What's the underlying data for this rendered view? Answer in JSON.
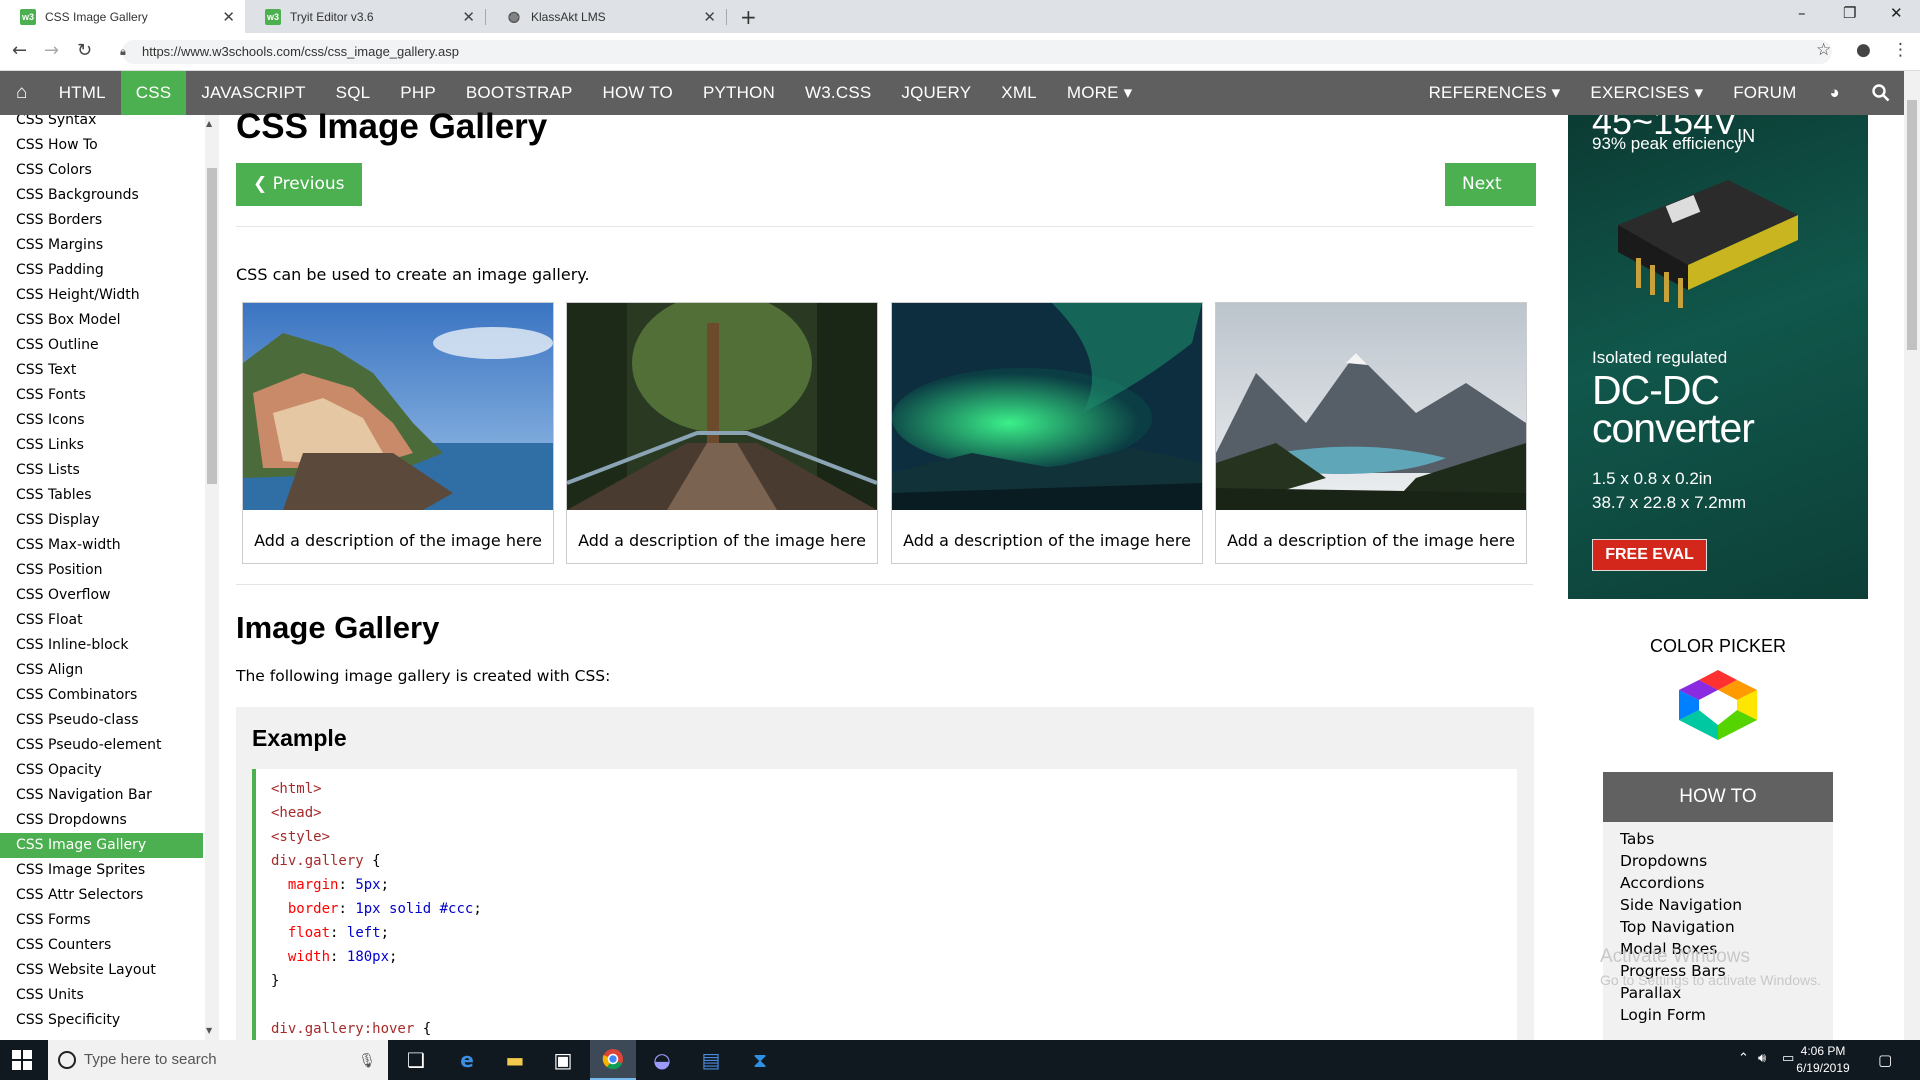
{
  "browser": {
    "tabs": [
      {
        "title": "CSS Image Gallery",
        "favicon": "w3"
      },
      {
        "title": "Tryit Editor v3.6",
        "favicon": "w3"
      },
      {
        "title": "KlassAkt LMS",
        "favicon": "globe"
      }
    ],
    "url": "https://www.w3schools.com/css/css_image_gallery.asp"
  },
  "topnav": {
    "items": [
      "HTML",
      "CSS",
      "JAVASCRIPT",
      "SQL",
      "PHP",
      "BOOTSTRAP",
      "HOW TO",
      "PYTHON",
      "W3.CSS",
      "JQUERY",
      "XML",
      "MORE ▾"
    ],
    "right_items": [
      "REFERENCES ▾",
      "EXERCISES ▾",
      "FORUM"
    ],
    "active": "CSS"
  },
  "sidebar": {
    "items": [
      "CSS Syntax",
      "CSS How To",
      "CSS Colors",
      "CSS Backgrounds",
      "CSS Borders",
      "CSS Margins",
      "CSS Padding",
      "CSS Height/Width",
      "CSS Box Model",
      "CSS Outline",
      "CSS Text",
      "CSS Fonts",
      "CSS Icons",
      "CSS Links",
      "CSS Lists",
      "CSS Tables",
      "CSS Display",
      "CSS Max-width",
      "CSS Position",
      "CSS Overflow",
      "CSS Float",
      "CSS Inline-block",
      "CSS Align",
      "CSS Combinators",
      "CSS Pseudo-class",
      "CSS Pseudo-element",
      "CSS Opacity",
      "CSS Navigation Bar",
      "CSS Dropdowns",
      "CSS Image Gallery",
      "CSS Image Sprites",
      "CSS Attr Selectors",
      "CSS Forms",
      "CSS Counters",
      "CSS Website Layout",
      "CSS Units",
      "CSS Specificity"
    ],
    "active": "CSS Image Gallery"
  },
  "main": {
    "title": "CSS Image Gallery",
    "previous": "❮ Previous",
    "next": "Next ❯",
    "intro": "CSS can be used to create an image gallery.",
    "gallery": [
      {
        "desc": "Add a description of the image here",
        "image": "cinque-terre"
      },
      {
        "desc": "Add a description of the image here",
        "image": "forest-bridge"
      },
      {
        "desc": "Add a description of the image here",
        "image": "northern-lights"
      },
      {
        "desc": "Add a description of the image here",
        "image": "mountain-lake"
      }
    ],
    "section_title": "Image Gallery",
    "section_text": "The following image gallery is created with CSS:",
    "example_heading": "Example"
  },
  "ad": {
    "top": "45~154V",
    "top_sub": "IN",
    "peak": "93% peak efficiency",
    "iso": "Isolated regulated",
    "dcdc_1": "DC-DC",
    "dcdc_2": "converter",
    "dim1": "1.5 x 0.8 x 0.2in",
    "dim2": "38.7 x 22.8 x 7.2mm",
    "cta": "FREE EVAL"
  },
  "color_picker": {
    "title": "COLOR PICKER"
  },
  "howto": {
    "title": "HOW TO",
    "items": [
      "Tabs",
      "Dropdowns",
      "Accordions",
      "Side Navigation",
      "Top Navigation",
      "Modal Boxes",
      "Progress Bars",
      "Parallax",
      "Login Form"
    ]
  },
  "watermark": {
    "line1": "Activate Windows",
    "line2": "Go to Settings to activate Windows."
  },
  "taskbar": {
    "search_placeholder": "Type here to search",
    "time": "4:06 PM",
    "date": "6/19/2019"
  },
  "colors": {
    "w3_green": "#4caf50",
    "nav_gray": "#5f5f5f",
    "ad_red": "#d3271b"
  }
}
